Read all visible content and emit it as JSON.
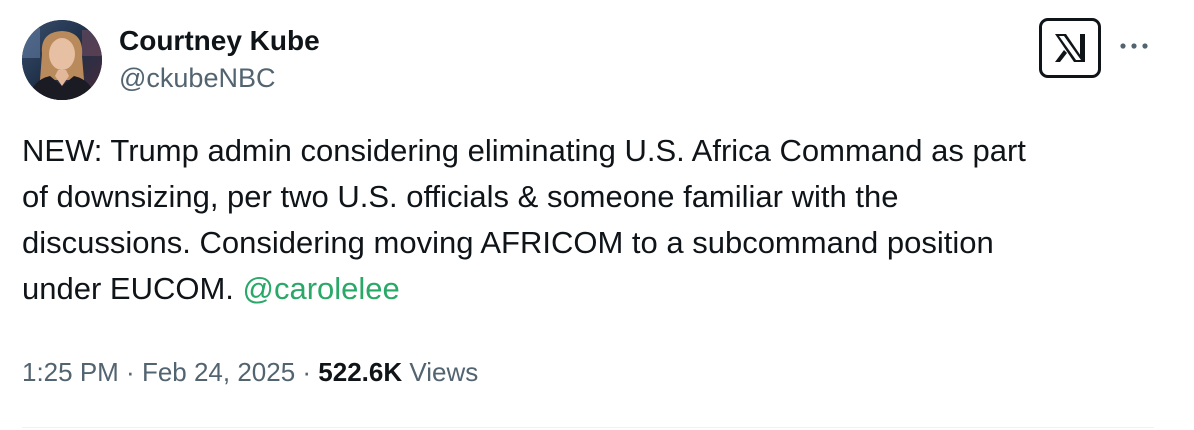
{
  "author": {
    "display_name": "Courtney Kube",
    "handle": "@ckubeNBC"
  },
  "tweet": {
    "text_lines": [
      "NEW: Trump admin considering eliminating U.S. Africa Command as part",
      "of downsizing, per two U.S. officials & someone familiar with the",
      "discussions. Considering moving AFRICOM to a subcommand position",
      "under EUCOM. "
    ],
    "mention": "@carolelee"
  },
  "meta": {
    "time": "1:25 PM",
    "separator": " · ",
    "date": "Feb 24, 2025",
    "views_count": "522.6K",
    "views_label": " Views"
  },
  "icons": {
    "logo": "x-logo-icon",
    "more": "more-dots-icon"
  },
  "colors": {
    "text": "#0f1419",
    "secondary": "#536471",
    "mention": "#2aa868"
  }
}
